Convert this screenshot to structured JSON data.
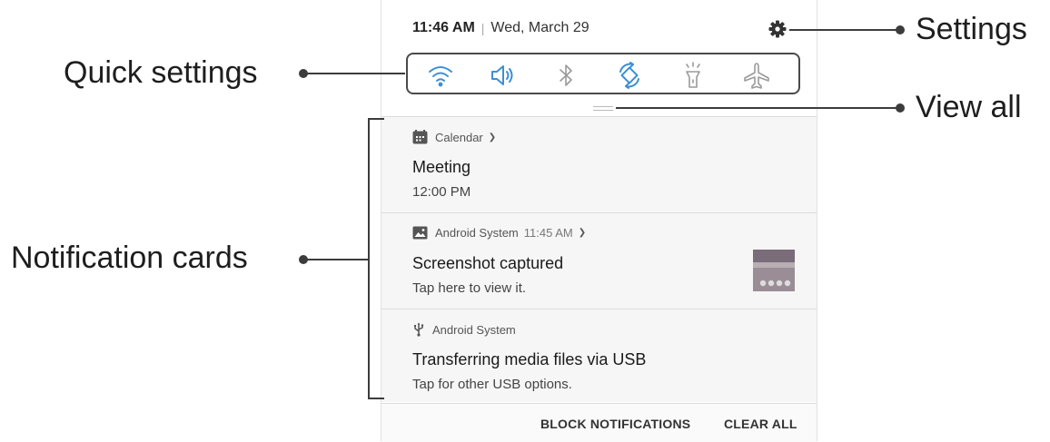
{
  "status": {
    "time": "11:46 AM",
    "separator": "|",
    "date": "Wed, March 29"
  },
  "quick_settings": [
    {
      "icon": "wifi-icon",
      "active": true
    },
    {
      "icon": "sound-icon",
      "active": true
    },
    {
      "icon": "bluetooth-icon",
      "active": false
    },
    {
      "icon": "auto-rotate-icon",
      "active": true
    },
    {
      "icon": "flashlight-icon",
      "active": false
    },
    {
      "icon": "airplane-mode-icon",
      "active": false
    }
  ],
  "notifications": [
    {
      "app": "Calendar",
      "time": "",
      "title": "Meeting",
      "text": "12:00 PM"
    },
    {
      "app": "Android System",
      "time": "11:45 AM",
      "title": "Screenshot captured",
      "text": "Tap here to view it."
    },
    {
      "app": "Android System",
      "time": "",
      "title": "Transferring media files via USB",
      "text": "Tap for other USB options."
    }
  ],
  "footer": {
    "block_label": "BLOCK NOTIFICATIONS",
    "clear_label": "CLEAR ALL"
  },
  "callouts": {
    "quick_settings": "Quick settings",
    "notification_cards": "Notification cards",
    "settings": "Settings",
    "view_all": "View all"
  },
  "colors": {
    "accent": "#3c8fd6",
    "inactive_icon": "#9a9a9a",
    "callout_line": "#3c3c3c"
  }
}
